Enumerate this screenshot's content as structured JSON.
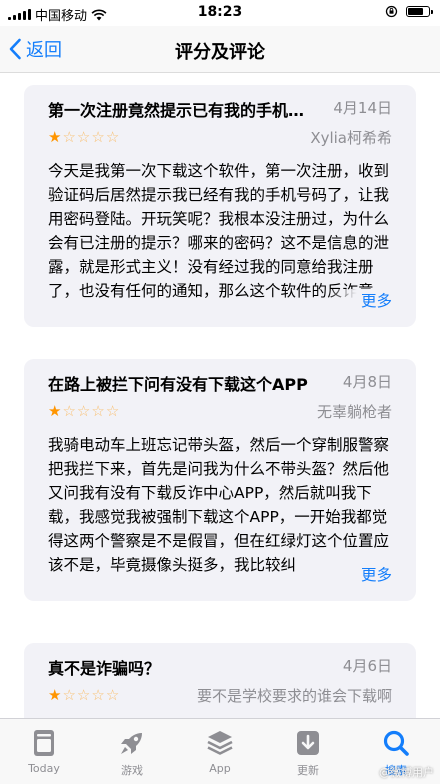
{
  "status_bar": {
    "carrier": "中国移动",
    "time": "18:23"
  },
  "nav": {
    "back_label": "返回",
    "title": "评分及评论"
  },
  "reviews": [
    {
      "title": "第一次注册竟然提示已有我的手机号码",
      "date": "4月14日",
      "author": "Xylia柯希希",
      "rating": 1,
      "body": "今天是我第一次下载这个软件，第一次注册，收到验证码后居然提示我已经有我的手机号码了，让我用密码登陆。开玩笑呢？我根本没注册过，为什么会有已注册的提示？哪来的密码？这不是信息的泄露，就是形式主义！没有经过我的同意给我注册了，也没有任何的通知，那么这个软件的反诈意",
      "more": "更多"
    },
    {
      "title": "在路上被拦下问有没有下载这个APP",
      "date": "4月8日",
      "author": "无辜躺枪者",
      "rating": 1,
      "body": "我骑电动车上班忘记带头盔，然后一个穿制服警察把我拦下来，首先是问我为什么不带头盔？然后他又问我有没有下载反诈中心APP，然后就叫我下载，我感觉我被强制下载这个APP，一开始我都觉得这两个警察是不是假冒，但在红绿灯这个位置应该不是，毕竟摄像头挺多，我比较纠",
      "more": "更多"
    },
    {
      "title": "真不是诈骗吗？",
      "date": "4月6日",
      "author": "要不是学校要求的谁会下载啊",
      "rating": 1,
      "body": "",
      "more": ""
    }
  ],
  "tabs": [
    {
      "label": "Today",
      "icon": "today-icon"
    },
    {
      "label": "游戏",
      "icon": "games-rocket-icon"
    },
    {
      "label": "App",
      "icon": "apps-stack-icon"
    },
    {
      "label": "更新",
      "icon": "updates-download-icon"
    },
    {
      "label": "搜索",
      "icon": "search-icon"
    }
  ],
  "active_tab": "搜索",
  "watermark": "@微博用户",
  "colors": {
    "accent": "#147efb",
    "star": "#ff9500",
    "secondary": "#8e8e93",
    "card_bg": "#f2f2f7"
  }
}
